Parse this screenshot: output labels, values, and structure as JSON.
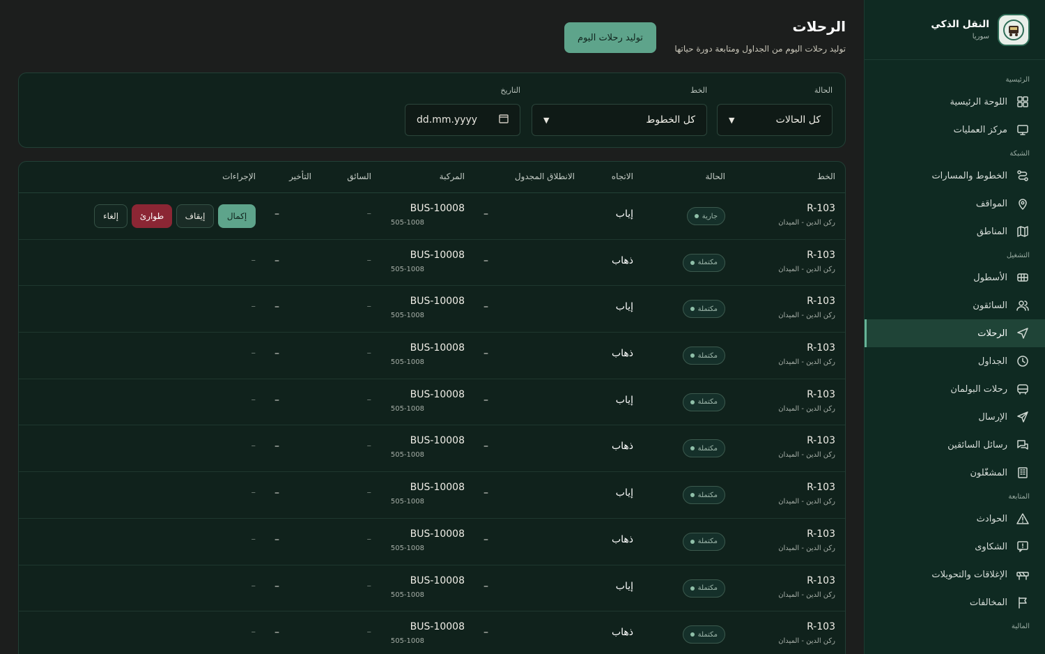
{
  "brand": {
    "title": "النقل الذكي",
    "subtitle": "سوريا"
  },
  "nav": {
    "sections": [
      {
        "label": "الرئيسية",
        "items": [
          {
            "label": "اللوحة الرئيسية",
            "icon": "grid-icon"
          },
          {
            "label": "مركز العمليات",
            "icon": "monitor-icon"
          }
        ]
      },
      {
        "label": "الشبكة",
        "items": [
          {
            "label": "الخطوط والمسارات",
            "icon": "route-icon"
          },
          {
            "label": "المواقف",
            "icon": "pin-icon"
          },
          {
            "label": "المناطق",
            "icon": "map-icon"
          }
        ]
      },
      {
        "label": "التشغيل",
        "items": [
          {
            "label": "الأسطول",
            "icon": "bus-icon"
          },
          {
            "label": "السائقون",
            "icon": "users-icon"
          },
          {
            "label": "الرحلات",
            "icon": "navigation-icon",
            "active": true
          },
          {
            "label": "الجداول",
            "icon": "clock-icon"
          },
          {
            "label": "رحلات البولمان",
            "icon": "coach-icon"
          },
          {
            "label": "الإرسال",
            "icon": "send-icon"
          },
          {
            "label": "رسائل السائقين",
            "icon": "chat-icon"
          },
          {
            "label": "المشغّلون",
            "icon": "building-icon"
          }
        ]
      },
      {
        "label": "المتابعة",
        "items": [
          {
            "label": "الحوادث",
            "icon": "warning-icon"
          },
          {
            "label": "الشكاوى",
            "icon": "message-alert-icon"
          },
          {
            "label": "الإغلاقات والتحويلات",
            "icon": "barrier-icon"
          },
          {
            "label": "المخالفات",
            "icon": "flag-icon"
          }
        ]
      },
      {
        "label": "المالية",
        "items": []
      }
    ]
  },
  "header": {
    "title": "الرحلات",
    "subtitle": "توليد رحلات اليوم من الجداول ومتابعة دورة حياتها",
    "generate_button": "توليد رحلات اليوم"
  },
  "filters": {
    "status_label": "الحالة",
    "status_value": "كل الحالات",
    "line_label": "الخط",
    "line_value": "كل الخطوط",
    "date_label": "التاريخ",
    "date_placeholder": "dd.mm.yyyy"
  },
  "table": {
    "columns": [
      "الخط",
      "الحالة",
      "الاتجاه",
      "الانطلاق المجدول",
      "المركبة",
      "السائق",
      "التأخير",
      "الإجراءات"
    ],
    "actions": {
      "complete": "إكمال",
      "pause": "إيقاف",
      "emergency": "طوارئ",
      "cancel": "إلغاء"
    },
    "rows": [
      {
        "line": "R-103",
        "line_name": "ركن الدين - الميدان",
        "status": "جارية",
        "direction": "إياب",
        "departure": "–",
        "vehicle": "BUS-10008",
        "plate": "505-1008",
        "driver": "–",
        "delay": "–",
        "actions_dash": "–"
      },
      {
        "line": "R-103",
        "line_name": "ركن الدين - الميدان",
        "status": "مكتملة",
        "direction": "ذهاب",
        "departure": "–",
        "vehicle": "BUS-10008",
        "plate": "505-1008",
        "driver": "–",
        "delay": "–",
        "actions_dash": "–"
      },
      {
        "line": "R-103",
        "line_name": "ركن الدين - الميدان",
        "status": "مكتملة",
        "direction": "إياب",
        "departure": "–",
        "vehicle": "BUS-10008",
        "plate": "505-1008",
        "driver": "–",
        "delay": "–",
        "actions_dash": "–"
      },
      {
        "line": "R-103",
        "line_name": "ركن الدين - الميدان",
        "status": "مكتملة",
        "direction": "ذهاب",
        "departure": "–",
        "vehicle": "BUS-10008",
        "plate": "505-1008",
        "driver": "–",
        "delay": "–",
        "actions_dash": "–"
      },
      {
        "line": "R-103",
        "line_name": "ركن الدين - الميدان",
        "status": "مكتملة",
        "direction": "إياب",
        "departure": "–",
        "vehicle": "BUS-10008",
        "plate": "505-1008",
        "driver": "–",
        "delay": "–",
        "actions_dash": "–"
      },
      {
        "line": "R-103",
        "line_name": "ركن الدين - الميدان",
        "status": "مكتملة",
        "direction": "ذهاب",
        "departure": "–",
        "vehicle": "BUS-10008",
        "plate": "505-1008",
        "driver": "–",
        "delay": "–",
        "actions_dash": "–"
      },
      {
        "line": "R-103",
        "line_name": "ركن الدين - الميدان",
        "status": "مكتملة",
        "direction": "إياب",
        "departure": "–",
        "vehicle": "BUS-10008",
        "plate": "505-1008",
        "driver": "–",
        "delay": "–",
        "actions_dash": "–"
      },
      {
        "line": "R-103",
        "line_name": "ركن الدين - الميدان",
        "status": "مكتملة",
        "direction": "ذهاب",
        "departure": "–",
        "vehicle": "BUS-10008",
        "plate": "505-1008",
        "driver": "–",
        "delay": "–",
        "actions_dash": "–"
      },
      {
        "line": "R-103",
        "line_name": "ركن الدين - الميدان",
        "status": "مكتملة",
        "direction": "إياب",
        "departure": "–",
        "vehicle": "BUS-10008",
        "plate": "505-1008",
        "driver": "–",
        "delay": "–",
        "actions_dash": "–"
      },
      {
        "line": "R-103",
        "line_name": "ركن الدين - الميدان",
        "status": "مكتملة",
        "direction": "ذهاب",
        "departure": "–",
        "vehicle": "BUS-10008",
        "plate": "505-1008",
        "driver": "–",
        "delay": "–",
        "actions_dash": "–"
      }
    ]
  },
  "colors": {
    "accent": "#5ea48b",
    "sidebar_bg": "#0f2a22",
    "emergency": "#8b2634",
    "page_bg": "#1c1e1d"
  }
}
